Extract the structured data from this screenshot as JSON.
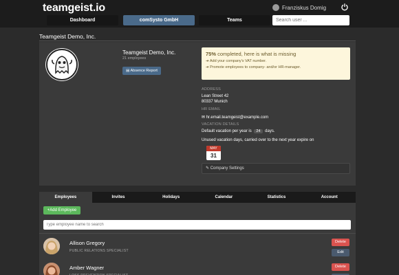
{
  "header": {
    "logo": "teamgeist.io",
    "user_name": "Franziskus Domig",
    "nav": {
      "dashboard": "Dashboard",
      "org": "comSysto GmbH",
      "teams": "Teams"
    },
    "search_placeholder": "Search user ..."
  },
  "company": {
    "title": "Teamgeist Demo, Inc.",
    "name": "Teamgeist Demo, Inc.",
    "employee_count": "21 employees",
    "absence_button": "Absence Report"
  },
  "completion": {
    "percent": "75%",
    "headline_rest": " completed, here is what is missing",
    "items": [
      "Add your company's VAT number.",
      "Promote employees to company- and/or HR-manager."
    ]
  },
  "details": {
    "address_label": "ADDRESS",
    "street": "Lean Street 42",
    "city": "80337 Munich",
    "hr_email_label": "HR EMAIL",
    "hr_email": "hr.email.teamgeist@example.com",
    "vacation_label": "VACATION DETAILS",
    "default_vacation_prefix": "Default vacation per year is",
    "default_vacation_days": "24",
    "default_vacation_suffix": "days.",
    "carryover_text": "Unused vacation days, carried over to the next year expire on",
    "expire_month": "MAY",
    "expire_day": "31",
    "settings_button": "Company Settings"
  },
  "tabs": [
    "Employees",
    "Invites",
    "Holidays",
    "Calendar",
    "Statistics",
    "Account"
  ],
  "employees_panel": {
    "add_button": "Add Employee",
    "search_placeholder": "Type employee name to search",
    "delete_label": "Delete",
    "edit_label": "Edit",
    "rows": [
      {
        "name": "Allison Gregory",
        "role": "PUBLIC RELATIONS SPECIALIST"
      },
      {
        "name": "Amber Wagner",
        "role": "LOSS PREVENTION SPECIALIST"
      }
    ]
  },
  "colors": {
    "accent": "#4a6a8a",
    "success": "#5cb85c",
    "danger": "#d9534f",
    "notice_bg": "#fdf6dc"
  }
}
